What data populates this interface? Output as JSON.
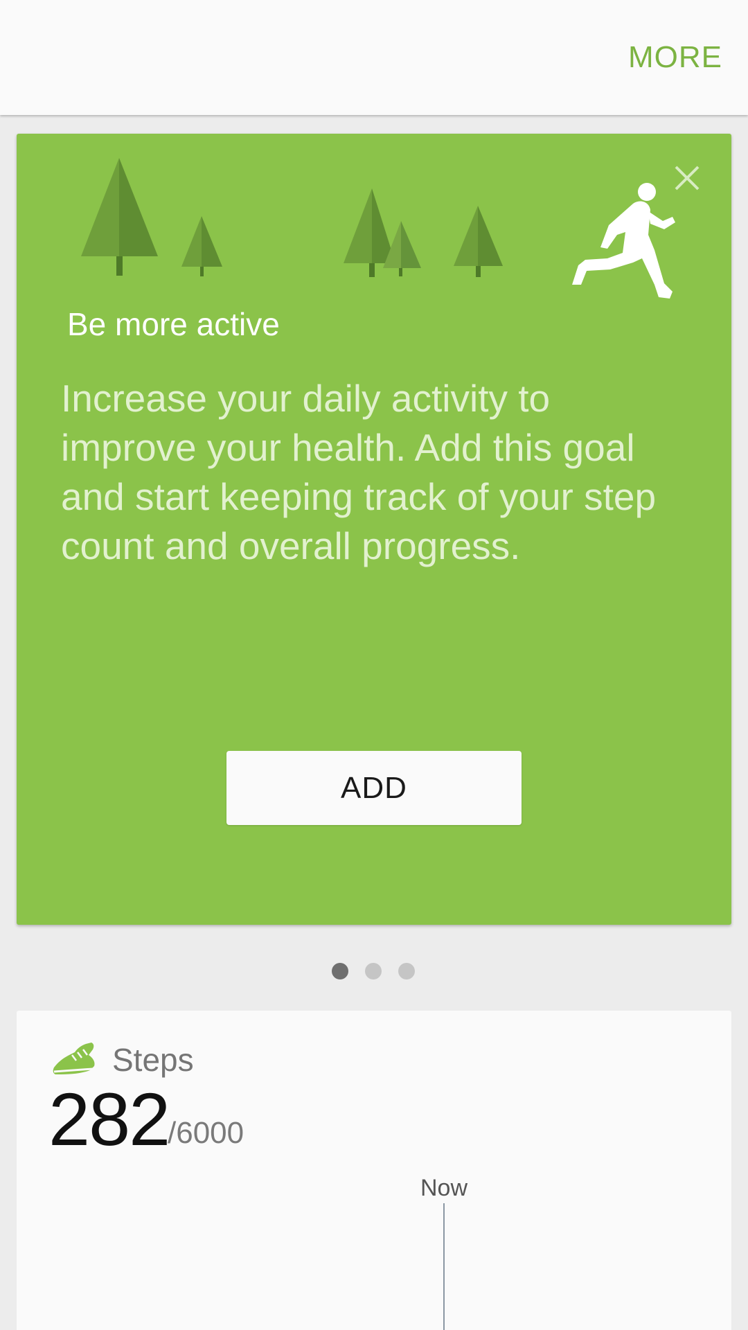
{
  "appbar": {
    "more_label": "MORE"
  },
  "goal_card": {
    "title": "Be more active",
    "body": "Increase your daily activity to improve your health. Add this goal and start keeping track of your step count and overall progress.",
    "add_label": "ADD",
    "background_color": "#8bc34a",
    "illustration_icon": "running-person-icon",
    "close_icon": "close-icon"
  },
  "pager": {
    "page_count": 3,
    "active_index": 0
  },
  "steps_card": {
    "label": "Steps",
    "count": "282",
    "goal": "/6000",
    "now_label": "Now",
    "icon": "shoe-icon"
  },
  "colors": {
    "accent": "#7cb342",
    "card_green": "#8bc34a",
    "background": "#ececec"
  }
}
